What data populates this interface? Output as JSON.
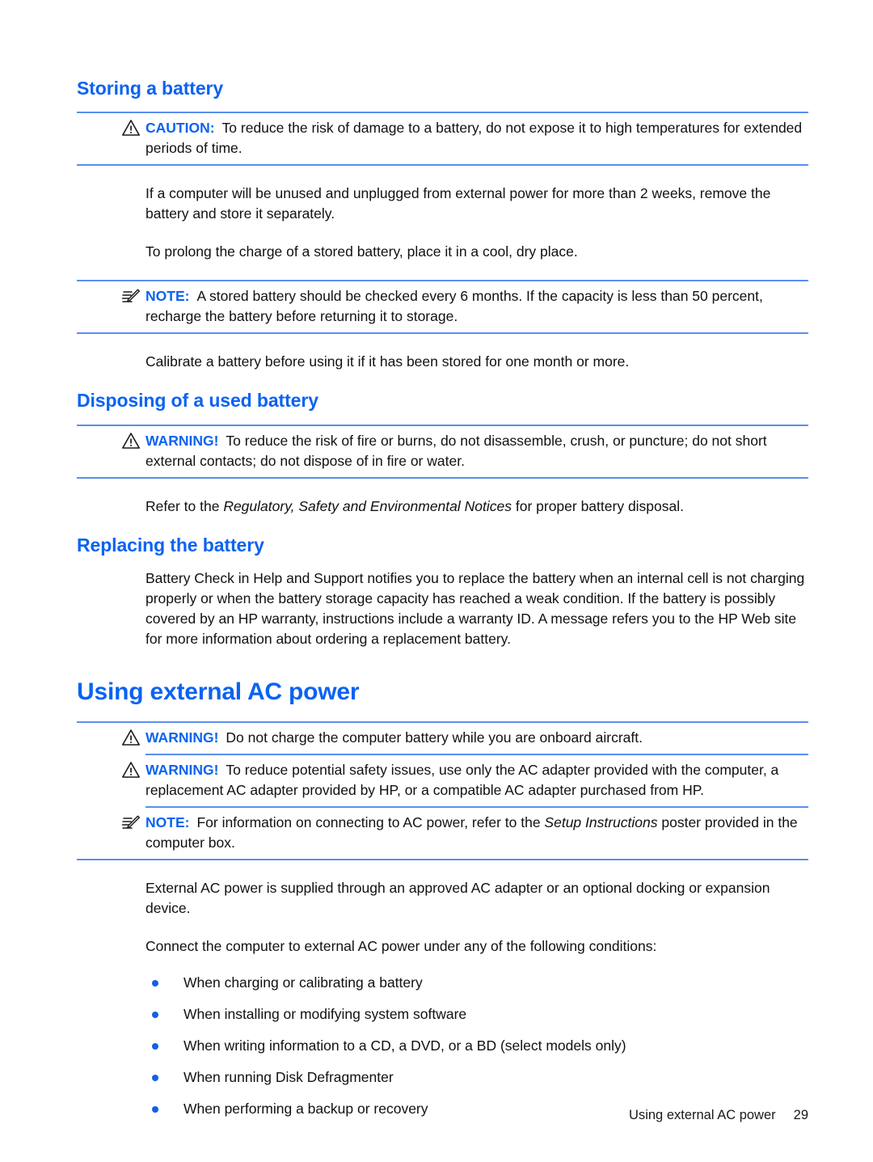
{
  "colors": {
    "heading_blue": "#0a63f2",
    "rule_blue": "#5a8ff0",
    "bullet_blue": "#1060e8",
    "body_text": "#111111",
    "page_background": "#ffffff"
  },
  "sections": [
    {
      "heading": "Storing a battery",
      "level": "h2"
    },
    {
      "heading": "Disposing of a used battery",
      "level": "h2"
    },
    {
      "heading": "Replacing the battery",
      "level": "h2"
    },
    {
      "heading": "Using external AC power",
      "level": "h1"
    }
  ],
  "storing_a_battery": {
    "heading": "Storing a battery",
    "caution": {
      "icon": "warning-triangle-icon",
      "label": "CAUTION:",
      "text": "To reduce the risk of damage to a battery, do not expose it to high temperatures for extended periods of time."
    },
    "paragraph_1": "If a computer will be unused and unplugged from external power for more than 2 weeks, remove the battery and store it separately.",
    "paragraph_2": "To prolong the charge of a stored battery, place it in a cool, dry place.",
    "note": {
      "icon": "note-pencil-icon",
      "label": "NOTE:",
      "text": "A stored battery should be checked every 6 months. If the capacity is less than 50 percent, recharge the battery before returning it to storage."
    },
    "paragraph_3": "Calibrate a battery before using it if it has been stored for one month or more."
  },
  "disposing_of_a_used_battery": {
    "heading": "Disposing of a used battery",
    "warning": {
      "icon": "warning-triangle-icon",
      "label": "WARNING!",
      "text": "To reduce the risk of fire or burns, do not disassemble, crush, or puncture; do not short external contacts; do not dispose of in fire or water."
    },
    "refer_text_before": "Refer to the ",
    "refer_text_italic": "Regulatory, Safety and Environmental Notices",
    "refer_text_after": " for proper battery disposal."
  },
  "replacing_the_battery": {
    "heading": "Replacing the battery",
    "paragraph_1": "Battery Check in Help and Support notifies you to replace the battery when an internal cell is not charging properly or when the battery storage capacity has reached a weak condition. If the battery is possibly covered by an HP warranty, instructions include a warranty ID. A message refers you to the HP Web site for more information about ordering a replacement battery."
  },
  "using_external_ac_power": {
    "heading": "Using external AC power",
    "warning_1": {
      "icon": "warning-triangle-icon",
      "label": "WARNING!",
      "text": "Do not charge the computer battery while you are onboard aircraft."
    },
    "warning_2": {
      "icon": "warning-triangle-icon",
      "label": "WARNING!",
      "text": "To reduce potential safety issues, use only the AC adapter provided with the computer, a replacement AC adapter provided by HP, or a compatible AC adapter purchased from HP."
    },
    "note": {
      "icon": "note-pencil-icon",
      "label": "NOTE:",
      "text_before": "For information on connecting to AC power, refer to the ",
      "text_italic": "Setup Instructions",
      "text_after": " poster provided in the computer box."
    },
    "paragraph_1": "External AC power is supplied through an approved AC adapter or an optional docking or expansion device.",
    "paragraph_2": "Connect the computer to external AC power under any of the following conditions:",
    "bullets": [
      "When charging or calibrating a battery",
      "When installing or modifying system software",
      "When writing information to a CD, a DVD, or a BD (select models only)",
      "When running Disk Defragmenter",
      "When performing a backup or recovery"
    ]
  },
  "footer": {
    "section_title": "Using external AC power",
    "page_number": "29"
  }
}
